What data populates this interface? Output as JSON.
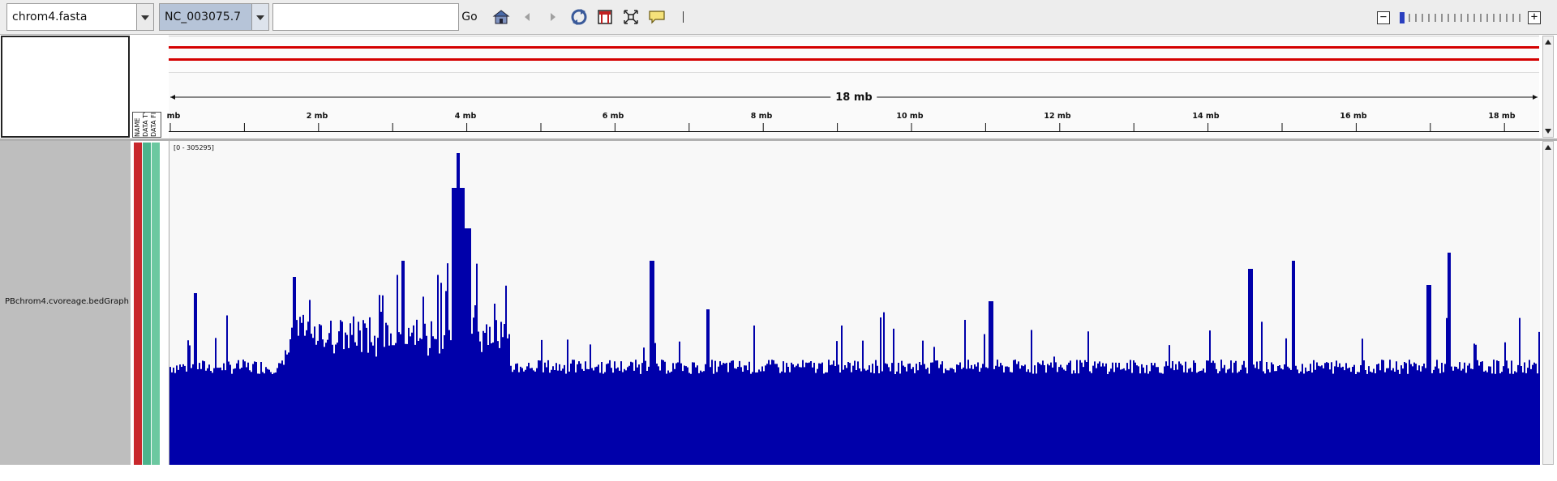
{
  "toolbar": {
    "genome_value": "chrom4.fasta",
    "chromosome_value": "NC_003075.7",
    "locus_value": "",
    "go_label": "Go",
    "icons": [
      "home-icon",
      "back-icon",
      "forward-icon",
      "refresh-icon",
      "region-icon",
      "fit-window-icon",
      "popup-text-icon"
    ],
    "zoom_minus": "−",
    "zoom_plus": "+",
    "zoom_level": 0
  },
  "header": {
    "scale_label": "18 mb",
    "tick_labels": [
      "mb",
      "2 mb",
      "4 mb",
      "6 mb",
      "8 mb",
      "10 mb",
      "12 mb",
      "14 mb",
      "16 mb",
      "18 mb"
    ],
    "attribute_headers": [
      "NAME",
      "DATA TYPE",
      "DATA FILE"
    ],
    "ideogram_color": "#d40000"
  },
  "track": {
    "name": "PBchrom4.cvoreage.bedGraph",
    "data_range": "[0 - 305295]",
    "color": "#0000aa",
    "attribute_colors": [
      "#c8282d",
      "#4cb48c",
      "#6cc8a0"
    ]
  }
}
